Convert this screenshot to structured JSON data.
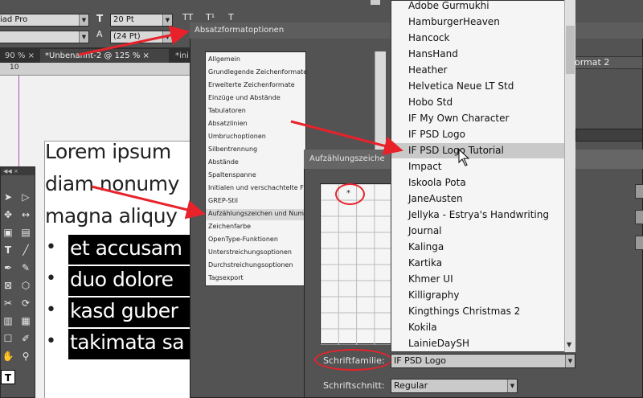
{
  "control_bar": {
    "font_name": "iad Pro",
    "font_size": "20 Pt",
    "leading": "(24 Pt)",
    "tt1": "TT",
    "tt2": "T¹",
    "tt3": "T",
    "italic_icon": "ℤ"
  },
  "tabs": {
    "zoom": "90 %",
    "close": "×",
    "active": "*Unbenannt-2 @ 125 %",
    "next": "*ini"
  },
  "ruler": {
    "mark": "10"
  },
  "document": {
    "lines": [
      "Lorem ipsum",
      "diam nonumy",
      "magna aliquy"
    ],
    "bullets": [
      "et accusam",
      "duo dolore",
      "kasd guber",
      "takimata sa"
    ],
    "bullet_char": "•"
  },
  "dialog": {
    "title": "Absatzformatoptionen",
    "categories": [
      "Allgemein",
      "Grundlegende Zeichenformate",
      "Erweiterte Zeichenformate",
      "Einzüge und Abstände",
      "Tabulatoren",
      "Absatzlinien",
      "Umbruchoptionen",
      "Silbentrennung",
      "Abstände",
      "Spaltenspanne",
      "Initialen und verschachtelte F",
      "GREP-Stil",
      "Aufzählungszeichen und Num",
      "Zeichenfarbe",
      "OpenType-Funktionen",
      "Unterstreichungsoptionen",
      "Durchstreichungsoptionen",
      "Tagsexport"
    ],
    "format_label": "ormat 2"
  },
  "inner_dialog": {
    "title": "Aufzählungszeiche",
    "glyph": "*",
    "font_family_label": "Schriftfamilie:",
    "font_family_value": "IF PSD Logo",
    "font_style_label": "Schriftschnitt:",
    "font_style_value": "Regular"
  },
  "font_list": {
    "items": [
      "Adobe Gurmukhi",
      "HamburgerHeaven",
      "Hancock",
      "HansHand",
      "Heather",
      "Helvetica Neue LT Std",
      "Hobo Std",
      "IF My Own Character",
      "IF PSD Logo",
      "IF PSD Logo Tutorial",
      "Impact",
      "Iskoola Pota",
      "JaneAusten",
      "Jellyka - Estrya's Handwriting",
      "Journal",
      "Kalinga",
      "Kartika",
      "Khmer UI",
      "Killigraphy",
      "Kingthings Christmas 2",
      "Kokila",
      "LainieDaySH"
    ],
    "selected": "IF PSD Logo Tutorial"
  },
  "colors": {
    "accent_red": "#e8222b",
    "selection": "#c9c9c9"
  }
}
